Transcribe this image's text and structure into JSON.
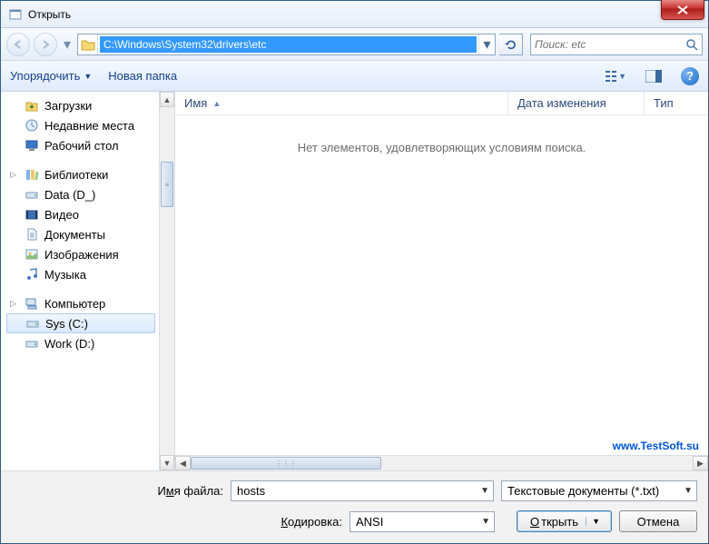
{
  "window": {
    "title": "Открыть"
  },
  "nav": {
    "path": "C:\\Windows\\System32\\drivers\\etc",
    "search_placeholder": "Поиск: etc"
  },
  "toolbar": {
    "organize": "Упорядочить",
    "new_folder": "Новая папка"
  },
  "sidebar": {
    "downloads": "Загрузки",
    "recent": "Недавние места",
    "desktop": "Рабочий стол",
    "libraries": "Библиотеки",
    "data": "Data (D_)",
    "video": "Видео",
    "documents": "Документы",
    "pictures": "Изображения",
    "music": "Музыка",
    "computer": "Компьютер",
    "sys": "Sys (C:)",
    "work": "Work (D:)"
  },
  "columns": {
    "name": "Имя",
    "date": "Дата изменения",
    "type": "Тип"
  },
  "list": {
    "empty": "Нет элементов, удовлетворяющих условиям поиска."
  },
  "watermark": "www.TestSoft.su",
  "footer": {
    "filename_label_pre": "И",
    "filename_label_u": "м",
    "filename_label_post": "я файла:",
    "filename_value": "hosts",
    "filter": "Текстовые документы (*.txt)",
    "encoding_label_pre": "",
    "encoding_label_u": "К",
    "encoding_label_post": "одировка:",
    "encoding_value": "ANSI",
    "open_pre": "",
    "open_u": "О",
    "open_post": "ткрыть",
    "cancel": "Отмена"
  }
}
